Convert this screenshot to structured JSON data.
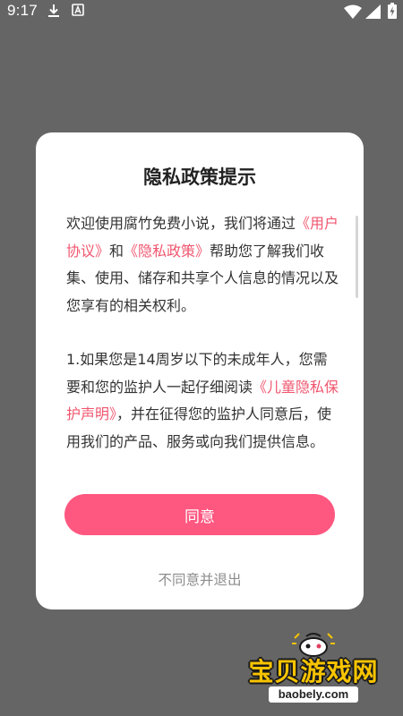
{
  "status_bar": {
    "time": "9:17",
    "icons": [
      "download-icon",
      "a-notification-icon",
      "wifi-icon",
      "signal-icon",
      "battery-charging-icon"
    ]
  },
  "dialog": {
    "title": "隐私政策提示",
    "paragraph1": {
      "part1": "欢迎使用腐竹免费小说，我们将通过",
      "link1": "《用户协议》",
      "part2": "和",
      "link2": "《隐私政策》",
      "part3": "帮助您了解我们收集、使用、储存和共享个人信息的情况以及您享有的相关权利。"
    },
    "paragraph2": {
      "part1": "1.如果您是14周岁以下的未成年人，您需要和您的监护人一起仔细阅读",
      "link1": "《儿童隐私保护声明》",
      "part2": "，并在征得您的监护人同意后，使用我们的产品、服务或向我们提供信息。"
    },
    "agree_label": "同意",
    "disagree_label": "不同意并退出"
  },
  "watermark": {
    "main": "宝贝游戏网",
    "sub": "baobely.com"
  },
  "colors": {
    "overlay": "#656565",
    "accent": "#fe5780",
    "link": "#f0566f",
    "watermark": "#f8c400"
  }
}
